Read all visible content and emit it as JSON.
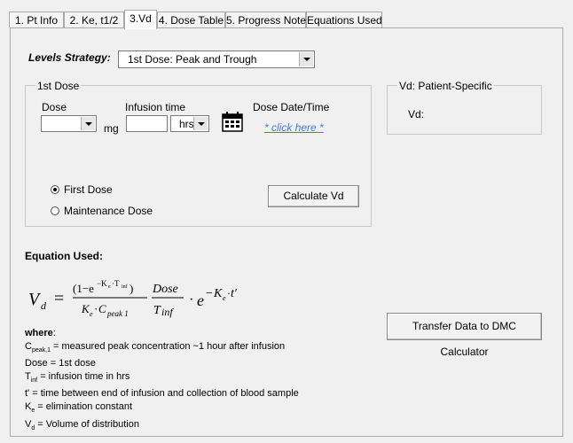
{
  "tabs": [
    {
      "label": "1. Pt Info",
      "active": false
    },
    {
      "label": "2. Ke, t1/2",
      "active": false
    },
    {
      "label": "3.Vd",
      "active": true
    },
    {
      "label": "4. Dose Table",
      "active": false
    },
    {
      "label": "5. Progress Note",
      "active": false
    },
    {
      "label": "Equations Used",
      "active": false
    }
  ],
  "strategy": {
    "label": "Levels Strategy:",
    "selected": "1st Dose: Peak and Trough"
  },
  "first_dose_group": {
    "title": "1st Dose",
    "dose_label": "Dose",
    "dose_value": "",
    "dose_unit": "mg",
    "infusion_label": "Infusion time",
    "infusion_value": "",
    "infusion_unit": "hrs",
    "datetime_label": "Dose Date/Time",
    "datetime_link": "* click here *",
    "radio_first": "First Dose",
    "radio_maintenance": "Maintenance Dose",
    "calculate_button": "Calculate Vd"
  },
  "vd_group": {
    "title": "Vd: Patient-Specific",
    "vd_label": "Vd:"
  },
  "equation": {
    "title": "Equation Used:"
  },
  "where": {
    "title": "where",
    "lines": [
      {
        "sym": "C",
        "sub": "peak,1",
        "text": " = measured peak concentration ~1 hour after infusion"
      },
      {
        "sym": "Dose",
        "sub": "",
        "text": " = 1st dose"
      },
      {
        "sym": "T",
        "sub": "inf",
        "text": " = infusion time in hrs"
      },
      {
        "sym": "t'",
        "sub": "",
        "text": " = time between end of infusion and collection of blood sample"
      },
      {
        "sym": "K",
        "sub": "e",
        "text": " = elimination constant"
      },
      {
        "sym": "V",
        "sub": "d",
        "text": " = Volume of distribution"
      }
    ]
  },
  "transfer_button": "Transfer Data to DMC Calculator"
}
